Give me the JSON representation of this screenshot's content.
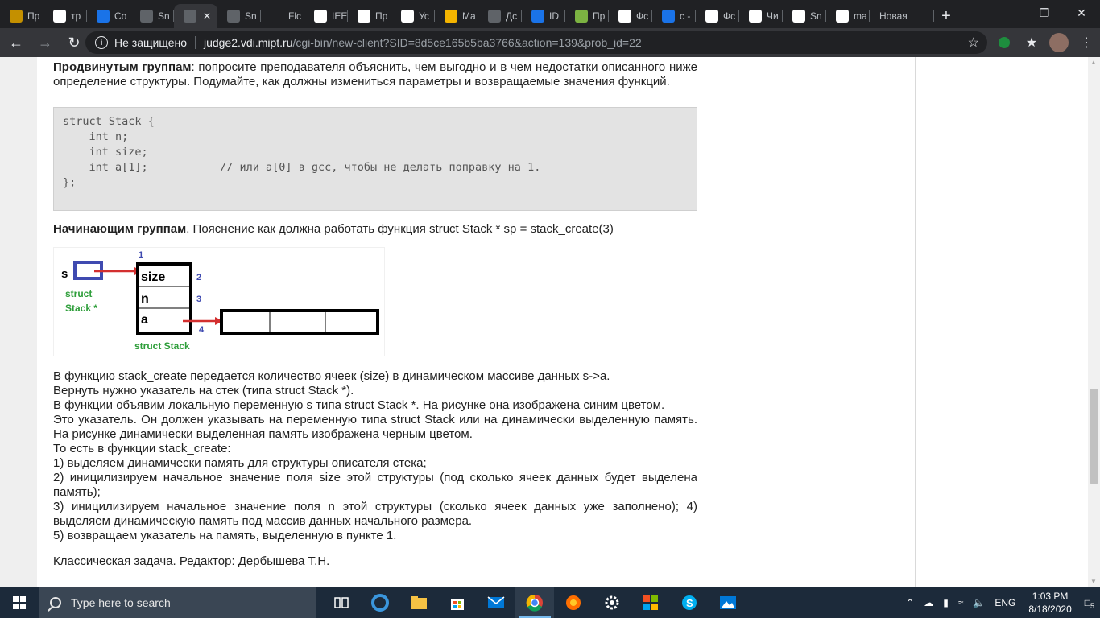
{
  "browser": {
    "tabs": [
      {
        "label": "Пр",
        "fav": "#c49000"
      },
      {
        "label": "тр",
        "fav": "#ffffff"
      },
      {
        "label": "Co",
        "fav": "#1a73e8"
      },
      {
        "label": "Sn",
        "fav": "#5f6368"
      },
      {
        "label": "",
        "fav": "#5f6368",
        "active": true
      },
      {
        "label": "Sn",
        "fav": "#5f6368"
      },
      {
        "label": "Flc",
        "fav": "#202124"
      },
      {
        "label": "IEE",
        "fav": "#ffffff"
      },
      {
        "label": "Пр",
        "fav": "#ffffff"
      },
      {
        "label": "Ус",
        "fav": "#ffffff"
      },
      {
        "label": "Ma",
        "fav": "#f4b400"
      },
      {
        "label": "Дс",
        "fav": "#5f6368"
      },
      {
        "label": "ID",
        "fav": "#1a73e8"
      },
      {
        "label": "Пр",
        "fav": "#7cb342"
      },
      {
        "label": "Фс",
        "fav": "#ffffff"
      },
      {
        "label": "c -",
        "fav": "#1a73e8"
      },
      {
        "label": "Фс",
        "fav": "#ffffff"
      },
      {
        "label": "Чи",
        "fav": "#ffffff"
      },
      {
        "label": "Sn",
        "fav": "#ffffff"
      },
      {
        "label": "ma",
        "fav": "#ffffff"
      },
      {
        "label": "Новая",
        "fav": ""
      }
    ],
    "not_secure": "Не защищено",
    "url_host": "judge2.vdi.mipt.ru",
    "url_path": "/cgi-bin/new-client?SID=8d5ce165b5ba3766&action=139&prob_id=22"
  },
  "article": {
    "advanced_bold": "Продвинутым группам",
    "advanced_text": ": попросите преподавателя объяснить, чем выгодно и в чем недостатки описанного ниже определение структуры. Подумайте, как должны измениться параметры и возвращаемые значения функций.",
    "code": "struct Stack {\n    int n;\n    int size;\n    int a[1];           // или a[0] в gcc, чтобы не делать поправку на 1.\n};",
    "beginner_bold": "Начинающим группам",
    "beginner_text": ". Пояснение как должна работать функция struct Stack * sp = stack_create(3)",
    "paragraphs": [
      "В функцию stack_create передается количество ячеек (size) в динамическом массиве данных s->a.",
      "Вернуть нужно указатель на стек (типа struct Stack *).",
      "В функции объявим локальную переменную s типа struct Stack *. На рисунке она изображена синим цветом.",
      "Это указатель. Он должен указывать на переменную типа struct Stack или на динамически выделенную память. На рисунке динамически выделенная память изображена черным цветом.",
      "То есть в функции stack_create:",
      "1) выделяем динамически память для структуры описателя стека;",
      "2) иницилизируем начальное значение поля size этой структуры (под сколько ячеек данных будет выделена память);",
      "3) иницилизируем начальное значение поля n этой структуры (сколько ячеек данных уже заполнено); 4) выделяем динамическую память под массив данных начального размера.",
      "5) возвращаем указатель на память, выделенную в пункте 1."
    ],
    "footer": "Классическая задача. Редактор: Дербышева Т.Н."
  },
  "diagram": {
    "var_name": "s",
    "var_type_line1": "struct",
    "var_type_line2": "Stack *",
    "fields": [
      "size",
      "n",
      "a"
    ],
    "struct_label": "struct Stack",
    "steps": [
      "1",
      "2",
      "3",
      "4"
    ]
  },
  "taskbar": {
    "search_placeholder": "Type here to search",
    "lang": "ENG",
    "time": "1:03 PM",
    "date": "8/18/2020",
    "notif_count": "5"
  }
}
